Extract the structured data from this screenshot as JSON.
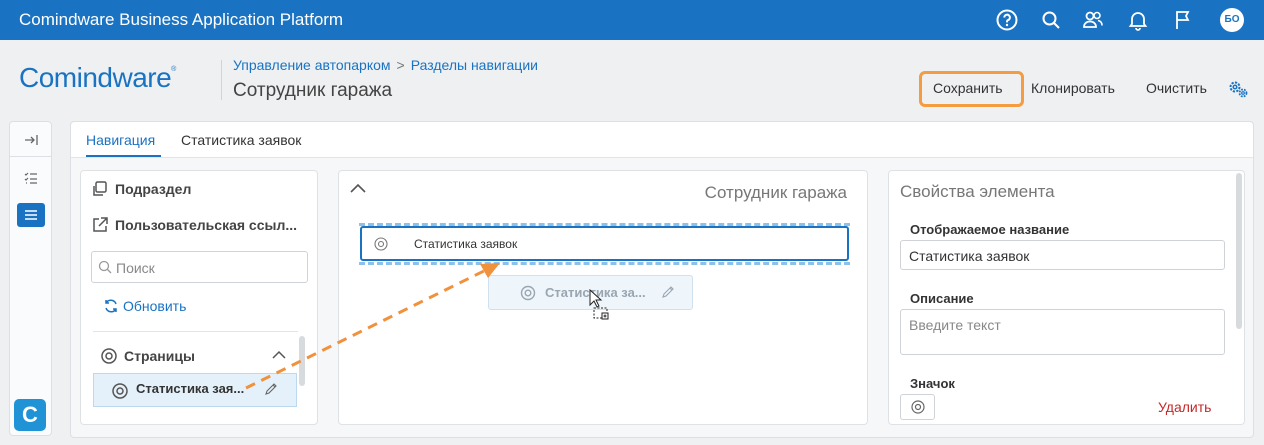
{
  "app": {
    "title": "Comindware Business Application Platform",
    "user_initials": "БО"
  },
  "header": {
    "logo_text": "Comindware",
    "logo_mark": "®",
    "breadcrumb": [
      "Управление автопарком",
      "Разделы навигации"
    ],
    "breadcrumb_separator": ">",
    "page_title": "Сотрудник гаража",
    "actions": {
      "save": "Сохранить",
      "clone": "Клонировать",
      "clear": "Очистить"
    }
  },
  "rail": {
    "items": [
      "collapse-icon",
      "checklist-icon",
      "menu-icon"
    ],
    "brand": "C"
  },
  "tabs": [
    {
      "label": "Навигация",
      "active": true
    },
    {
      "label": "Статистика заявок",
      "active": false
    }
  ],
  "left_panel": {
    "subsection": "Подраздел",
    "custom_link": "Пользовательская ссыл...",
    "search_placeholder": "Поиск",
    "refresh": "Обновить",
    "group_title": "Страницы",
    "item": "Статистика зая..."
  },
  "middle_panel": {
    "title": "Сотрудник гаража",
    "item": "Статистика заявок",
    "drag_item": "Статистика за..."
  },
  "right_panel": {
    "title": "Свойства элемента",
    "display_name_label": "Отображаемое название",
    "display_name_value": "Статистика заявок",
    "description_label": "Описание",
    "description_placeholder": "Введите текст",
    "icon_label": "Значок",
    "delete": "Удалить"
  },
  "colors": {
    "accent": "#1a73c2",
    "highlight": "#f59b42",
    "danger": "#c62828"
  }
}
